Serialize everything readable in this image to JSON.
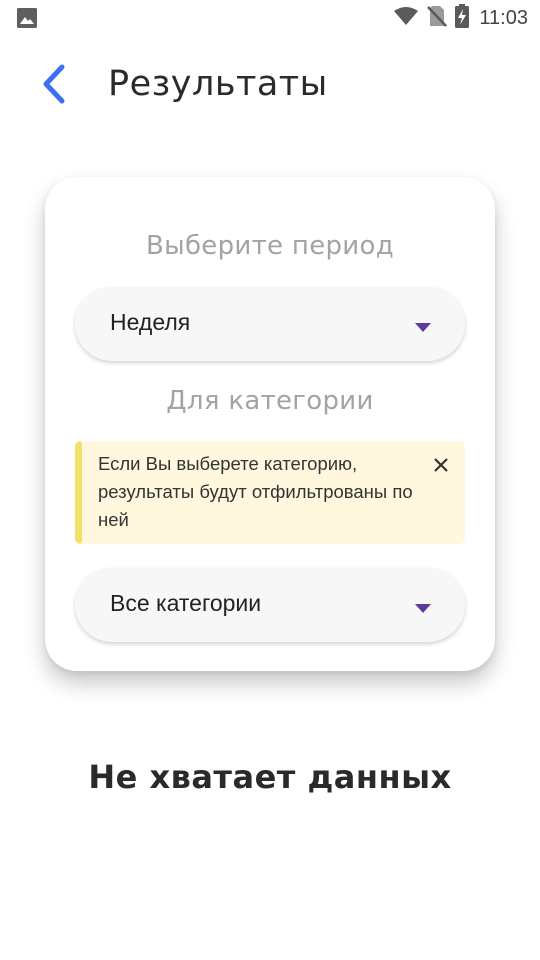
{
  "status_bar": {
    "time": "11:03",
    "icons": [
      "image-icon",
      "wifi-icon",
      "no-sim-icon",
      "battery-charging-icon"
    ]
  },
  "header": {
    "back_icon": "chevron-left-icon",
    "title": "Результаты"
  },
  "filters": {
    "period_label": "Выберите период",
    "period_value": "Неделя",
    "category_label": "Для категории",
    "info_text": "Если Вы выберете категорию, результаты будут отфильтрованы по ней",
    "category_value": "Все категории"
  },
  "empty_state": {
    "message": "Не хватает данных"
  },
  "colors": {
    "accent_back": "#3d6ff0",
    "dropdown_arrow": "#5e3a9a",
    "info_background": "#fff8de",
    "info_stripe": "#f4e065"
  }
}
